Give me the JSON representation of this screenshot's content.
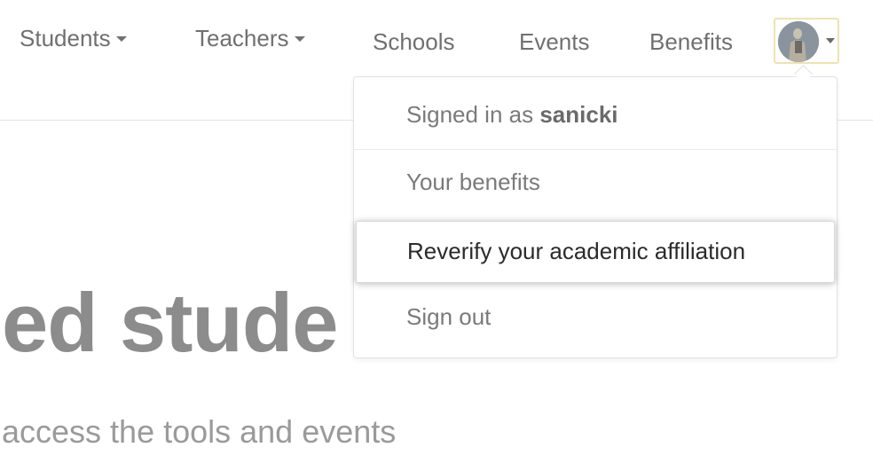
{
  "nav": {
    "students": "Students",
    "teachers": "Teachers",
    "schools": "Schools",
    "events": "Events",
    "benefits": "Benefits"
  },
  "account_menu": {
    "signed_in_prefix": "Signed in as",
    "username": "sanicki",
    "your_benefits": "Your benefits",
    "reverify": "Reverify your academic affiliation",
    "sign_out": "Sign out"
  },
  "hero": {
    "title_fragment": "ed stude",
    "subtitle_fragment": "access the tools and events"
  },
  "colors": {
    "accent_border": "#efe3b0",
    "text": "#707070",
    "highlight_text": "#2b2b2b"
  }
}
